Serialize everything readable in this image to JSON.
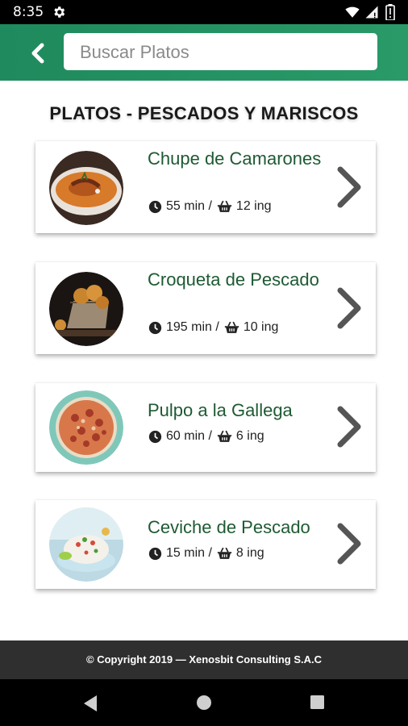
{
  "status_bar": {
    "time": "8:35",
    "icons": [
      "gear-icon",
      "wifi-icon",
      "signal-icon",
      "battery-icon"
    ]
  },
  "app_bar": {
    "back_icon": "chevron-left-icon",
    "search": {
      "placeholder": "Buscar Platos",
      "value": ""
    },
    "colors": {
      "primary": "#1f8a5d"
    }
  },
  "section_title": "PLATOS - PESCADOS Y MARISCOS",
  "dishes": [
    {
      "name": "Chupe de Camarones",
      "time": "55 min /",
      "ingredients": "12 ing"
    },
    {
      "name": "Croqueta de Pescado",
      "time": "195 min /",
      "ingredients": "10 ing"
    },
    {
      "name": "Pulpo a la Gallega",
      "time": "60 min /",
      "ingredients": "6 ing"
    },
    {
      "name": "Ceviche de Pescado",
      "time": "15 min /",
      "ingredients": "8 ing"
    }
  ],
  "footer": {
    "copyright": "© Copyright 2019 — Xenosbit Consulting S.A.C"
  },
  "nav_bar": {
    "icons": [
      "back-triangle-icon",
      "home-circle-icon",
      "recents-square-icon"
    ]
  }
}
